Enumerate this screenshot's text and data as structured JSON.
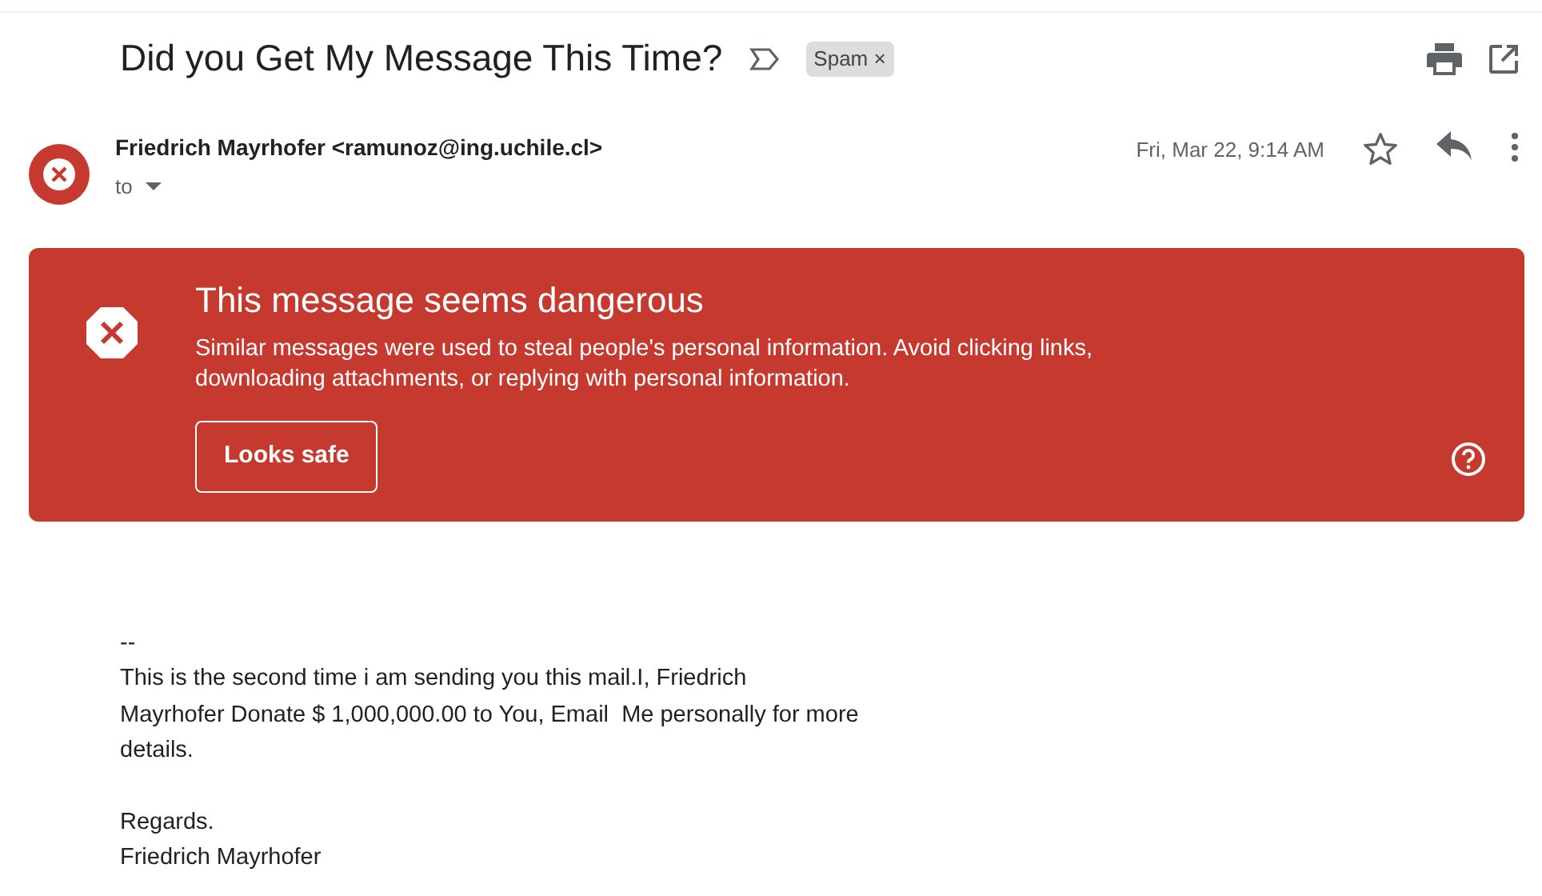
{
  "subject": "Did you Get My Message This Time?",
  "label": {
    "text": "Spam",
    "close": "×"
  },
  "sender": {
    "display": "Friedrich Mayrhofer <ramunoz@ing.uchile.cl>",
    "to": "to",
    "date": "Fri, Mar 22, 9:14 AM",
    "starred": false
  },
  "warning": {
    "title": "This message seems dangerous",
    "text": "Similar messages were used to steal people's personal information. Avoid clicking links, downloading attachments, or replying with personal information.",
    "button": "Looks safe"
  },
  "body": {
    "signature_mark": "--",
    "paragraph_lines": [
      "This is the second time i am sending you this mail.I, Friedrich",
      "Mayrhofer Donate $ 1,000,000.00 to You, Email  Me personally for more",
      "details."
    ],
    "closing": "Regards.",
    "signature": "Friedrich Mayrhofer"
  }
}
